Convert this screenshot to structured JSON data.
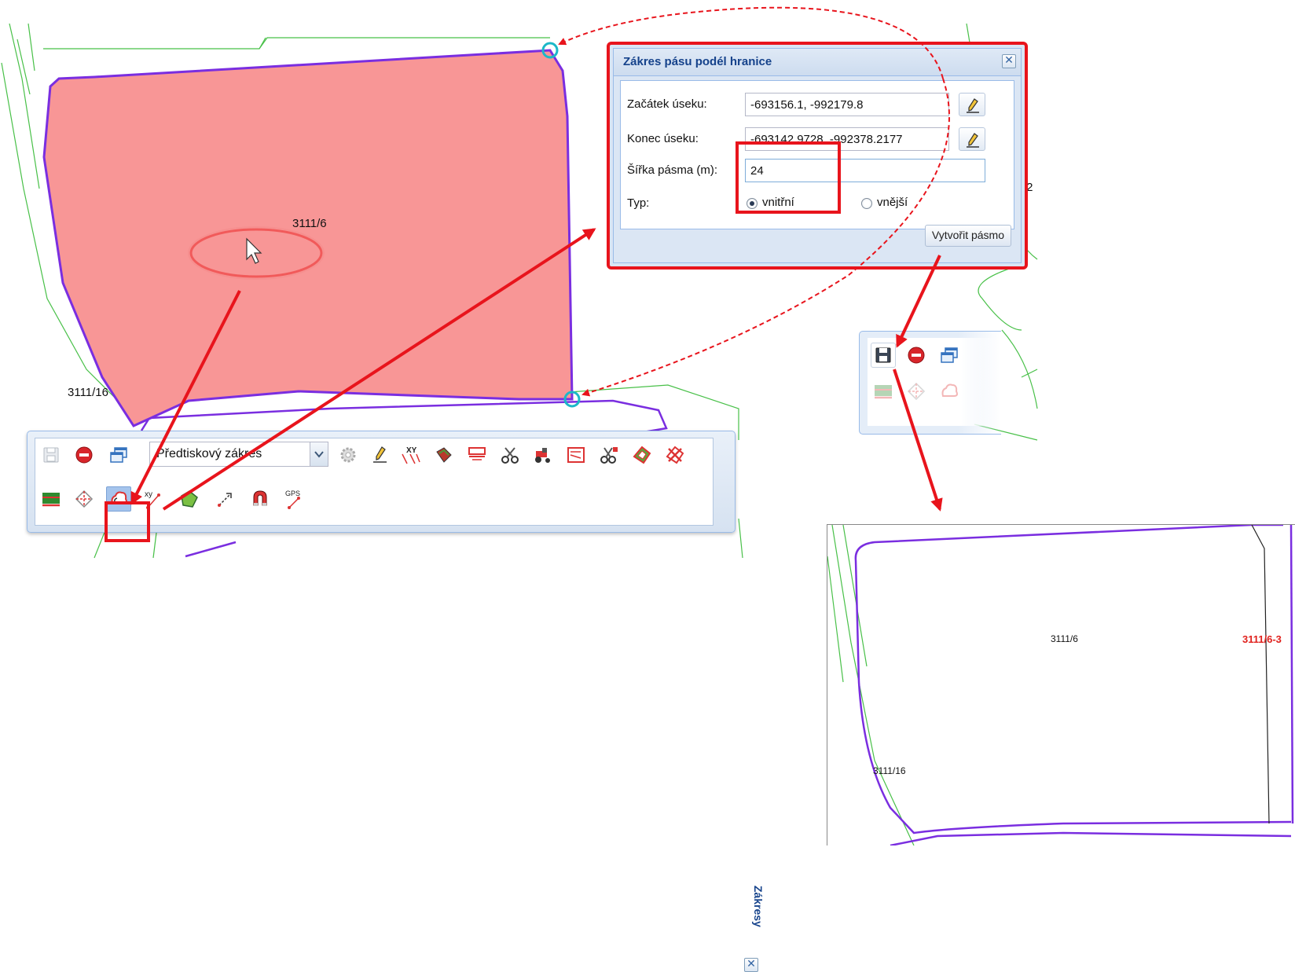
{
  "map": {
    "parcel_main_label": "3111/6",
    "parcel_neighbor_label": "3111/16",
    "parcel_partial_label": "/2"
  },
  "dialog": {
    "title": "Zákres pásu podél hranice",
    "start_label": "Začátek úseku:",
    "start_value": "-693156.1, -992179.8",
    "end_label": "Konec úseku:",
    "end_value": "-693142.9728, -992378.2177",
    "width_label": "Šířka pásma (m):",
    "width_value": "24",
    "type_label": "Typ:",
    "type_options": [
      "vnitřní",
      "vnější"
    ],
    "type_selected": "vnitřní",
    "create_button": "Vytvořit pásmo",
    "close_glyph": "✕"
  },
  "toolbar": {
    "title": "Zákresy",
    "select_value": "Předtiskový zákres",
    "close_glyph": "✕",
    "row1_icons": [
      "save-icon",
      "stop-icon",
      "windows-icon",
      "settings-icon",
      "pencil-icon",
      "xy-points-icon",
      "layer-icon",
      "split-line-icon",
      "scissors-icon",
      "tractor-icon",
      "map-book-icon",
      "cut-points-icon",
      "polygon-layers-icon",
      "delete-polygons-icon"
    ],
    "row2_icons": [
      "field-icon",
      "edit-vertex-icon",
      "buffer-border-icon",
      "xy-line-icon",
      "green-polygon-icon",
      "arrow-line-icon",
      "magnet-icon",
      "gps-icon"
    ],
    "xy_text": "XY",
    "gps_text": "GPS"
  },
  "mini_toolbar": {
    "icons": [
      "save-icon",
      "stop-icon",
      "windows-icon",
      "field-icon",
      "edit-vertex-icon",
      "buffer-border-icon"
    ]
  },
  "result": {
    "main_label": "3111/6",
    "neighbor_label": "3111/16",
    "new_label": "3111/6-3"
  },
  "colors": {
    "highlight_red": "#e8141c",
    "parcel_fill": "#f89696",
    "parcel_border": "#7a2ee0",
    "map_lines": "#48c048",
    "vertex": "#1cb8c8",
    "panel_blue": "#99bbe8"
  }
}
